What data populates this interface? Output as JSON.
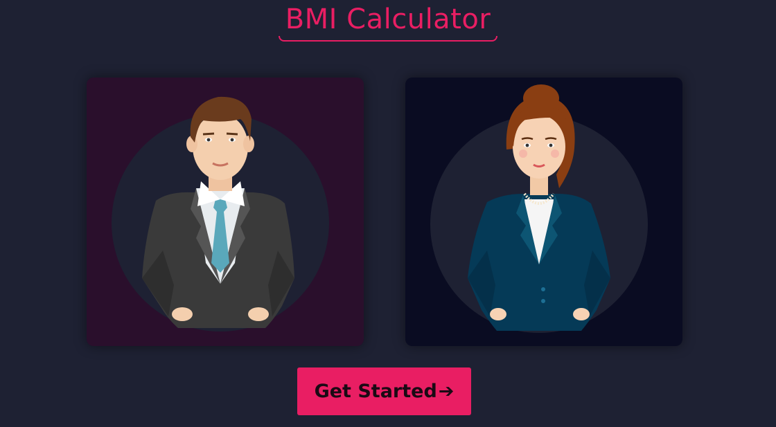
{
  "header": {
    "title": "BMI Calculator"
  },
  "cards": {
    "male": {
      "icon": "man-avatar-icon"
    },
    "female": {
      "icon": "woman-avatar-icon"
    }
  },
  "cta": {
    "label": "Get Started",
    "arrow": "➔"
  },
  "colors": {
    "background": "#1e2133",
    "accent": "#e91e63",
    "male_card": "#2a0f2c",
    "female_card": "#0a0c22"
  }
}
